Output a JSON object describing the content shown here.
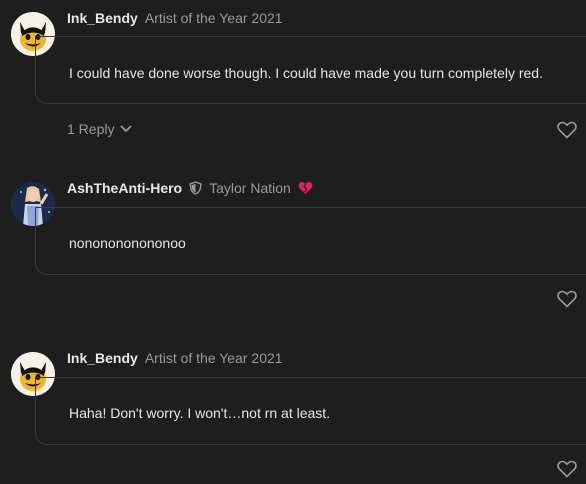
{
  "comments": [
    {
      "username": "Ink_Bendy",
      "flair": "Artist of the Year 2021",
      "text": "I could have done worse though. I could have made you turn completely red.",
      "reply_label": "1 Reply"
    },
    {
      "username": "AshTheAnti-Hero",
      "flair": "Taylor Nation",
      "text": "nononononononoo"
    },
    {
      "username": "Ink_Bendy",
      "flair": "Artist of the Year 2021",
      "text": "Haha! Don't worry. I won't…not rn at least."
    }
  ],
  "colors": {
    "background": "#1e1e1e",
    "text": "#e6e6e6",
    "muted": "#9a9a9a",
    "avatar_bg": "#f6f2e8",
    "bendy_face": "#f0b530",
    "heart": "#e0245e"
  },
  "icons": {
    "like": "heart-outline-icon",
    "reply_toggle": "chevron-down-icon",
    "moderator": "shield-icon",
    "fan_badge": "broken-heart-icon"
  }
}
